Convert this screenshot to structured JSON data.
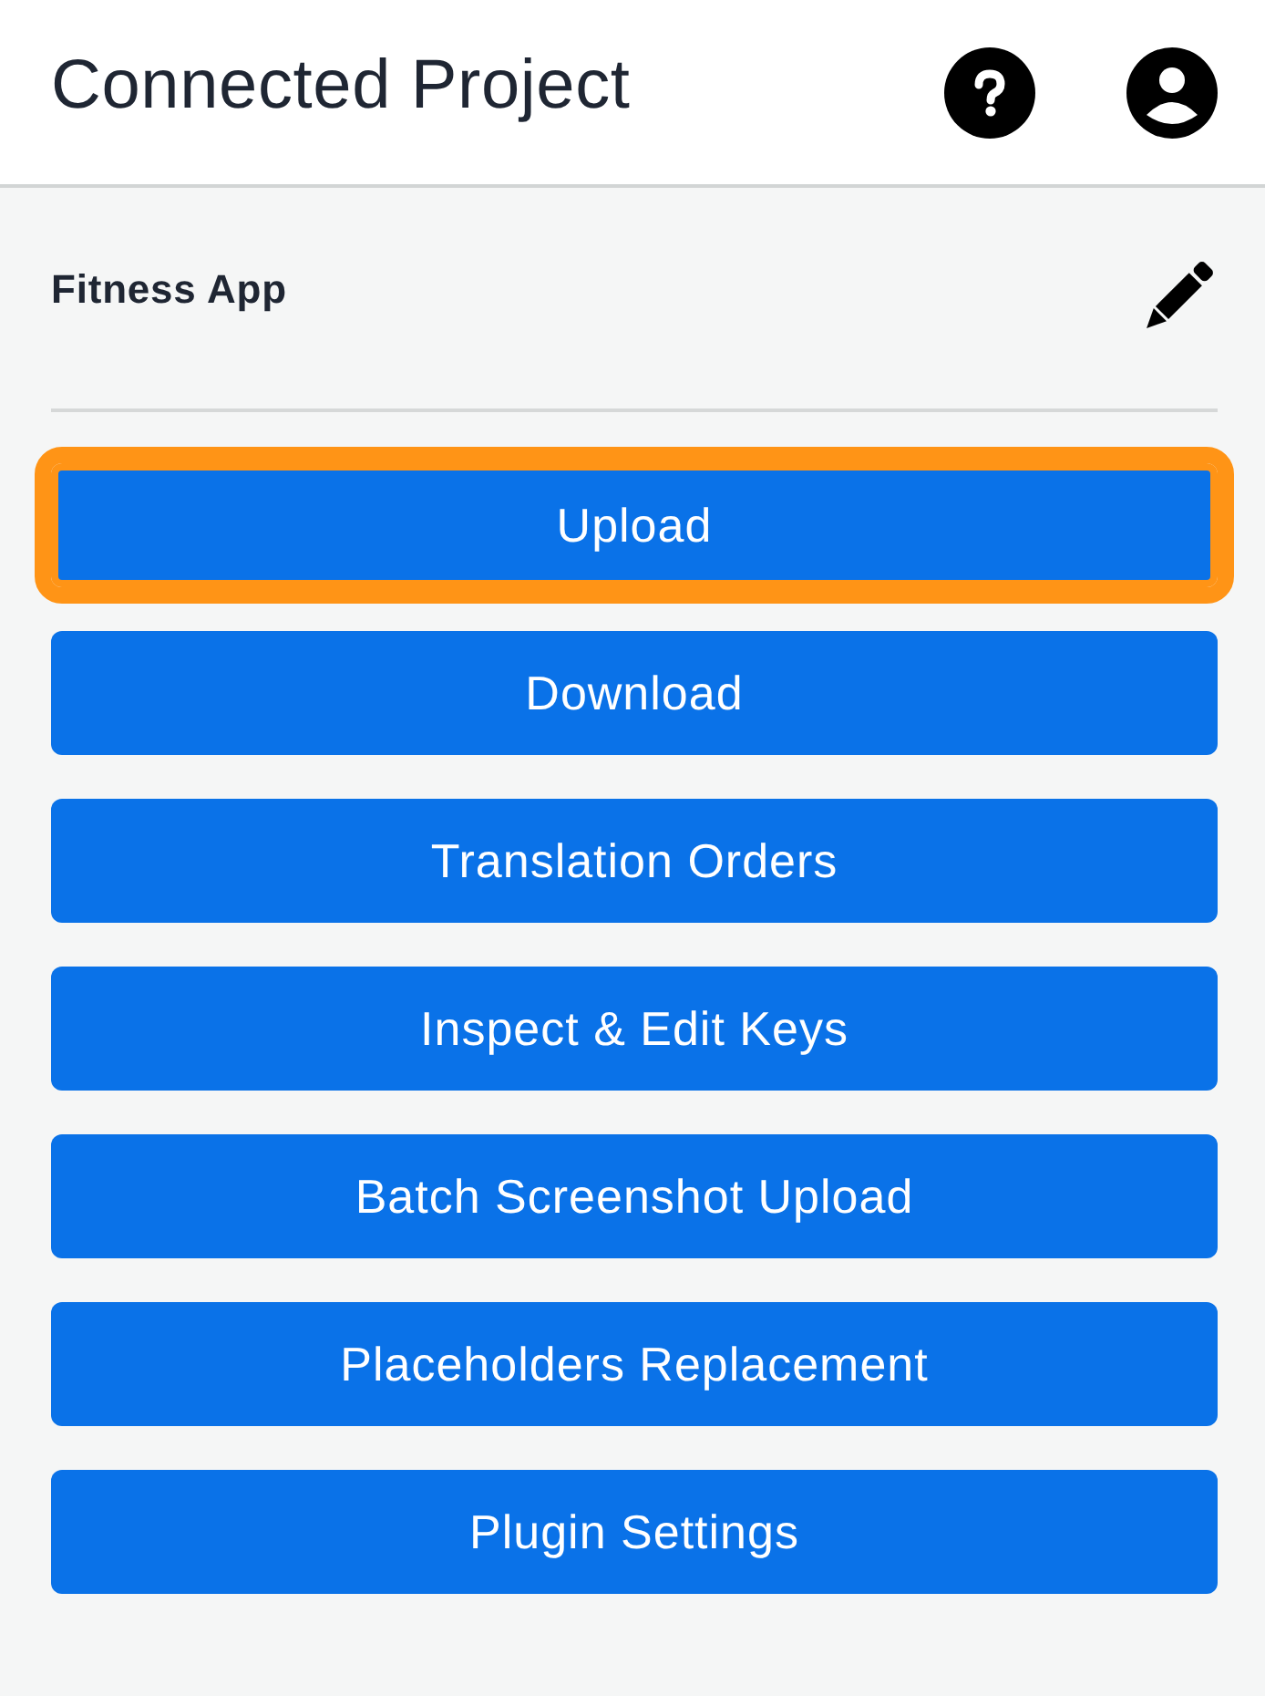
{
  "header": {
    "title": "Connected Project"
  },
  "project": {
    "name": "Fitness App"
  },
  "actions": [
    {
      "label": "Upload",
      "focused": true
    },
    {
      "label": "Download",
      "focused": false
    },
    {
      "label": "Translation Orders",
      "focused": false
    },
    {
      "label": "Inspect & Edit Keys",
      "focused": false
    },
    {
      "label": "Batch Screenshot Upload",
      "focused": false
    },
    {
      "label": "Placeholders Replacement",
      "focused": false
    },
    {
      "label": "Plugin Settings",
      "focused": false
    }
  ]
}
